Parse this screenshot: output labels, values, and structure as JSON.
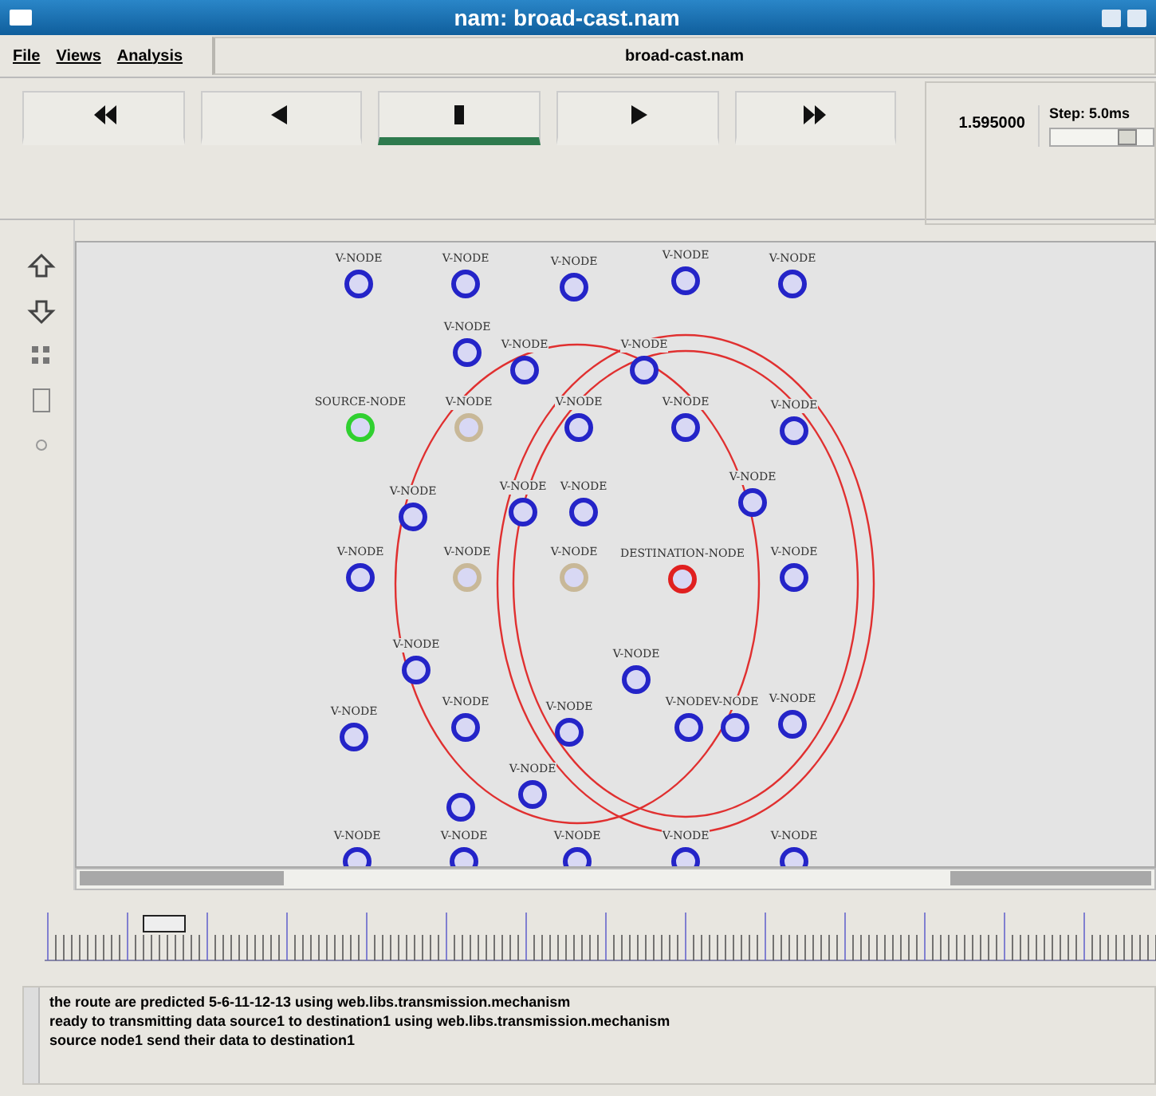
{
  "window": {
    "title": "nam: broad-cast.nam"
  },
  "menu": [
    {
      "label": "File"
    },
    {
      "label": "Views"
    },
    {
      "label": "Analysis"
    }
  ],
  "file_name": "broad-cast.nam",
  "controls": [
    {
      "kind": "rewind",
      "selected": false
    },
    {
      "kind": "back",
      "selected": false
    },
    {
      "kind": "stop",
      "selected": true
    },
    {
      "kind": "play",
      "selected": false
    },
    {
      "kind": "forward",
      "selected": false
    }
  ],
  "time": "1.595000",
  "step": {
    "label": "Step: 5.0ms",
    "level": 0.8
  },
  "nodes": [
    {
      "label": "V-NODE",
      "color": "#2424c8"
    },
    {
      "label": "V-NODE",
      "color": "#2424c8"
    },
    {
      "label": "V-NODE",
      "color": "#2424c8"
    },
    {
      "label": "V-NODE",
      "color": "#2424c8"
    },
    {
      "label": "V-NODE",
      "color": "#2424c8"
    },
    {
      "label": "V-NODE",
      "color": "#2424c8"
    },
    {
      "label": "V-NODE",
      "color": "#2424c8"
    },
    {
      "label": "V-NODE",
      "color": "#2424c8"
    },
    {
      "label": "SOURCE-NODE",
      "color": "#30d030"
    },
    {
      "label": "V-NODE",
      "color": "#c8b898"
    },
    {
      "label": "V-NODE",
      "color": "#2424c8"
    },
    {
      "label": "V-NODE",
      "color": "#2424c8"
    },
    {
      "label": "V-NODE",
      "color": "#2424c8"
    },
    {
      "label": "V-NODE",
      "color": "#2424c8"
    },
    {
      "label": "V-NODE",
      "color": "#2424c8"
    },
    {
      "label": "V-NODE",
      "color": "#2424c8"
    },
    {
      "label": "V-NODE",
      "color": "#2424c8"
    },
    {
      "label": "V-NODE",
      "color": "#2424c8"
    },
    {
      "label": "V-NODE",
      "color": "#c8b898"
    },
    {
      "label": "V-NODE",
      "color": "#c8b898"
    },
    {
      "label": "DESTINATION-NODE",
      "color": "#e02020"
    },
    {
      "label": "V-NODE",
      "color": "#2424c8"
    },
    {
      "label": "V-NODE",
      "color": "#2424c8"
    },
    {
      "label": "V-NODE",
      "color": "#2424c8"
    },
    {
      "label": "V-NODE",
      "color": "#2424c8"
    },
    {
      "label": "V-NODE",
      "color": "#2424c8"
    },
    {
      "label": "V-NODE",
      "color": "#2424c8"
    },
    {
      "label": "V-NODE",
      "color": "#2424c8"
    },
    {
      "label": "V-NODE",
      "color": "#2424c8"
    },
    {
      "label": "V-NODE",
      "color": "#2424c8"
    },
    {
      "label": "V-NODE",
      "color": "#2424c8"
    },
    {
      "color": "#2424c8"
    },
    {
      "label": "V-NODE",
      "color": "#2424c8"
    },
    {
      "label": "V-NODE",
      "color": "#2424c8"
    },
    {
      "label": "V-NODE",
      "color": "#2424c8"
    },
    {
      "label": "V-NODE",
      "color": "#2424c8"
    },
    {
      "label": "V-NODE",
      "color": "#2424c8"
    }
  ],
  "log": [
    "the route are predicted 5-6-11-12-13 using web.libs.transmission.mechanism",
    "ready to transmitting data source1 to destination1 using web.libs.transmission.mechanism",
    "source node1 send their data to destination1"
  ]
}
